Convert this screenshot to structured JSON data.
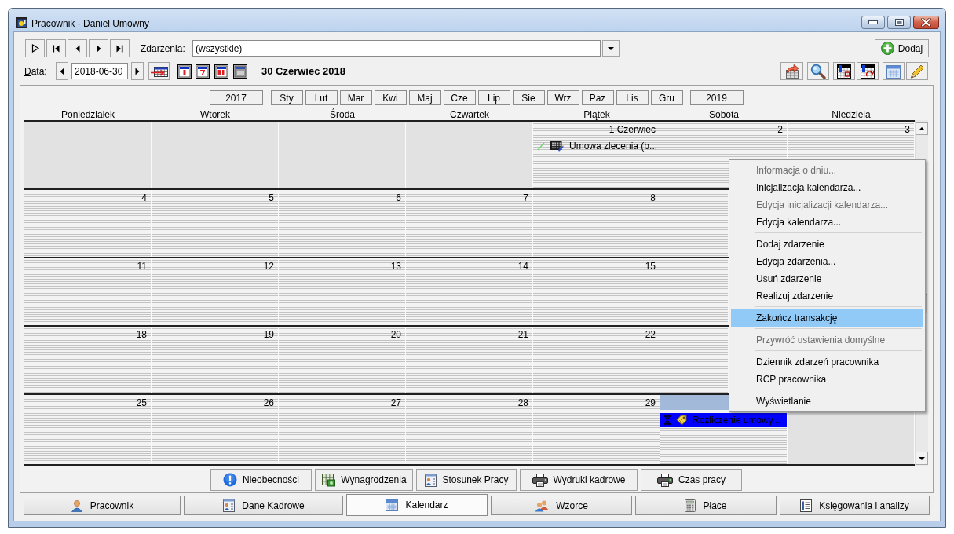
{
  "window": {
    "title": "Pracownik - Daniel Umowny"
  },
  "toolbar": {
    "events_filter": {
      "label": "Zdarzenia:",
      "value": "(wszystkie)"
    },
    "add_button": "Dodaj",
    "date": {
      "label": "Data:",
      "value": "2018-06-30"
    },
    "date_heading": "30 Czerwiec 2018"
  },
  "calendar": {
    "prev_year": "2017",
    "months": [
      "Sty",
      "Lut",
      "Mar",
      "Kwi",
      "Maj",
      "Cze",
      "Lip",
      "Sie",
      "Wrz",
      "Paz",
      "Lis",
      "Gru"
    ],
    "next_year": "2019",
    "weekdays": [
      "Poniedziałek",
      "Wtorek",
      "Środa",
      "Czwartek",
      "Piątek",
      "Sobota",
      "Niedziela"
    ],
    "weeks": [
      {
        "days": [
          {
            "in_month": false,
            "selected": false
          },
          {
            "in_month": false,
            "selected": false
          },
          {
            "in_month": false,
            "selected": false
          },
          {
            "in_month": false,
            "selected": false
          },
          {
            "in_month": true,
            "selected": false,
            "label": "1 Czerwiec",
            "events": [
              {
                "text": "Umowa zlecenia (b...",
                "kind": "contract",
                "selected": false
              }
            ]
          },
          {
            "in_month": true,
            "selected": false,
            "label": "2"
          },
          {
            "in_month": true,
            "selected": false,
            "label": "3"
          }
        ]
      },
      {
        "days": [
          {
            "in_month": true,
            "selected": false,
            "label": "4"
          },
          {
            "in_month": true,
            "selected": false,
            "label": "5"
          },
          {
            "in_month": true,
            "selected": false,
            "label": "6"
          },
          {
            "in_month": true,
            "selected": false,
            "label": "7"
          },
          {
            "in_month": true,
            "selected": false,
            "label": "8"
          },
          {
            "in_month": true,
            "selected": false
          }
        ]
      },
      {
        "days": [
          {
            "in_month": true,
            "selected": false,
            "label": "11"
          },
          {
            "in_month": true,
            "selected": false,
            "label": "12"
          },
          {
            "in_month": true,
            "selected": false,
            "label": "13"
          },
          {
            "in_month": true,
            "selected": false,
            "label": "14"
          },
          {
            "in_month": true,
            "selected": false,
            "label": "15"
          },
          {
            "in_month": true,
            "selected": false
          }
        ]
      },
      {
        "days": [
          {
            "in_month": true,
            "selected": false,
            "label": "18"
          },
          {
            "in_month": true,
            "selected": false,
            "label": "19"
          },
          {
            "in_month": true,
            "selected": false,
            "label": "20"
          },
          {
            "in_month": true,
            "selected": false,
            "label": "21"
          },
          {
            "in_month": true,
            "selected": false,
            "label": "22"
          },
          {
            "in_month": true,
            "selected": false
          }
        ]
      },
      {
        "days": [
          {
            "in_month": true,
            "selected": false,
            "label": "25"
          },
          {
            "in_month": true,
            "selected": false,
            "label": "26"
          },
          {
            "in_month": true,
            "selected": false,
            "label": "27"
          },
          {
            "in_month": true,
            "selected": false,
            "label": "28"
          },
          {
            "in_month": true,
            "selected": false,
            "label": "29"
          },
          {
            "in_month": true,
            "selected": true,
            "events": [
              {
                "text": "Rozliczenie umowy...",
                "kind": "settlement",
                "selected": true
              }
            ]
          },
          {
            "in_month": false
          }
        ]
      }
    ]
  },
  "bottom_buttons": [
    "Nieobecności",
    "Wynagrodzenia",
    "Stosunek Pracy",
    "Wydruki kadrowe",
    "Czas pracy"
  ],
  "tabs": [
    {
      "label": "Pracownik",
      "selected": false
    },
    {
      "label": "Dane Kadrowe",
      "selected": false
    },
    {
      "label": "Kalendarz",
      "selected": true
    },
    {
      "label": "Wzorce",
      "selected": false
    },
    {
      "label": "Płace",
      "selected": false
    },
    {
      "label": "Księgowania i analizy",
      "selected": false
    }
  ],
  "context_menu": [
    {
      "items": [
        {
          "label": "Informacja o dniu...",
          "disabled": true,
          "selected": false
        },
        {
          "label": "Inicjalizacja kalendarza...",
          "disabled": false,
          "selected": false
        },
        {
          "label": "Edycja inicjalizacji kalendarza...",
          "disabled": true,
          "selected": false
        },
        {
          "label": "Edycja kalendarza...",
          "disabled": false,
          "selected": false
        }
      ]
    },
    {
      "items": [
        {
          "label": "Dodaj zdarzenie",
          "disabled": false,
          "selected": false
        },
        {
          "label": "Edycja zdarzenia...",
          "disabled": false,
          "selected": false
        },
        {
          "label": "Usuń zdarzenie",
          "disabled": false,
          "selected": false
        },
        {
          "label": "Realizuj zdarzenie",
          "disabled": false,
          "selected": false
        }
      ]
    },
    {
      "items": [
        {
          "label": "Zakończ transakcję",
          "disabled": false,
          "selected": true
        }
      ]
    },
    {
      "items": [
        {
          "label": "Przywróć ustawienia domyślne",
          "disabled": true,
          "selected": false
        }
      ]
    },
    {
      "items": [
        {
          "label": "Dziennik zdarzeń pracownika",
          "disabled": false,
          "selected": false
        },
        {
          "label": "RCP pracownika",
          "disabled": false,
          "selected": false
        }
      ]
    },
    {
      "items": [
        {
          "label": "Wyświetlanie",
          "disabled": false,
          "selected": false
        }
      ]
    }
  ]
}
